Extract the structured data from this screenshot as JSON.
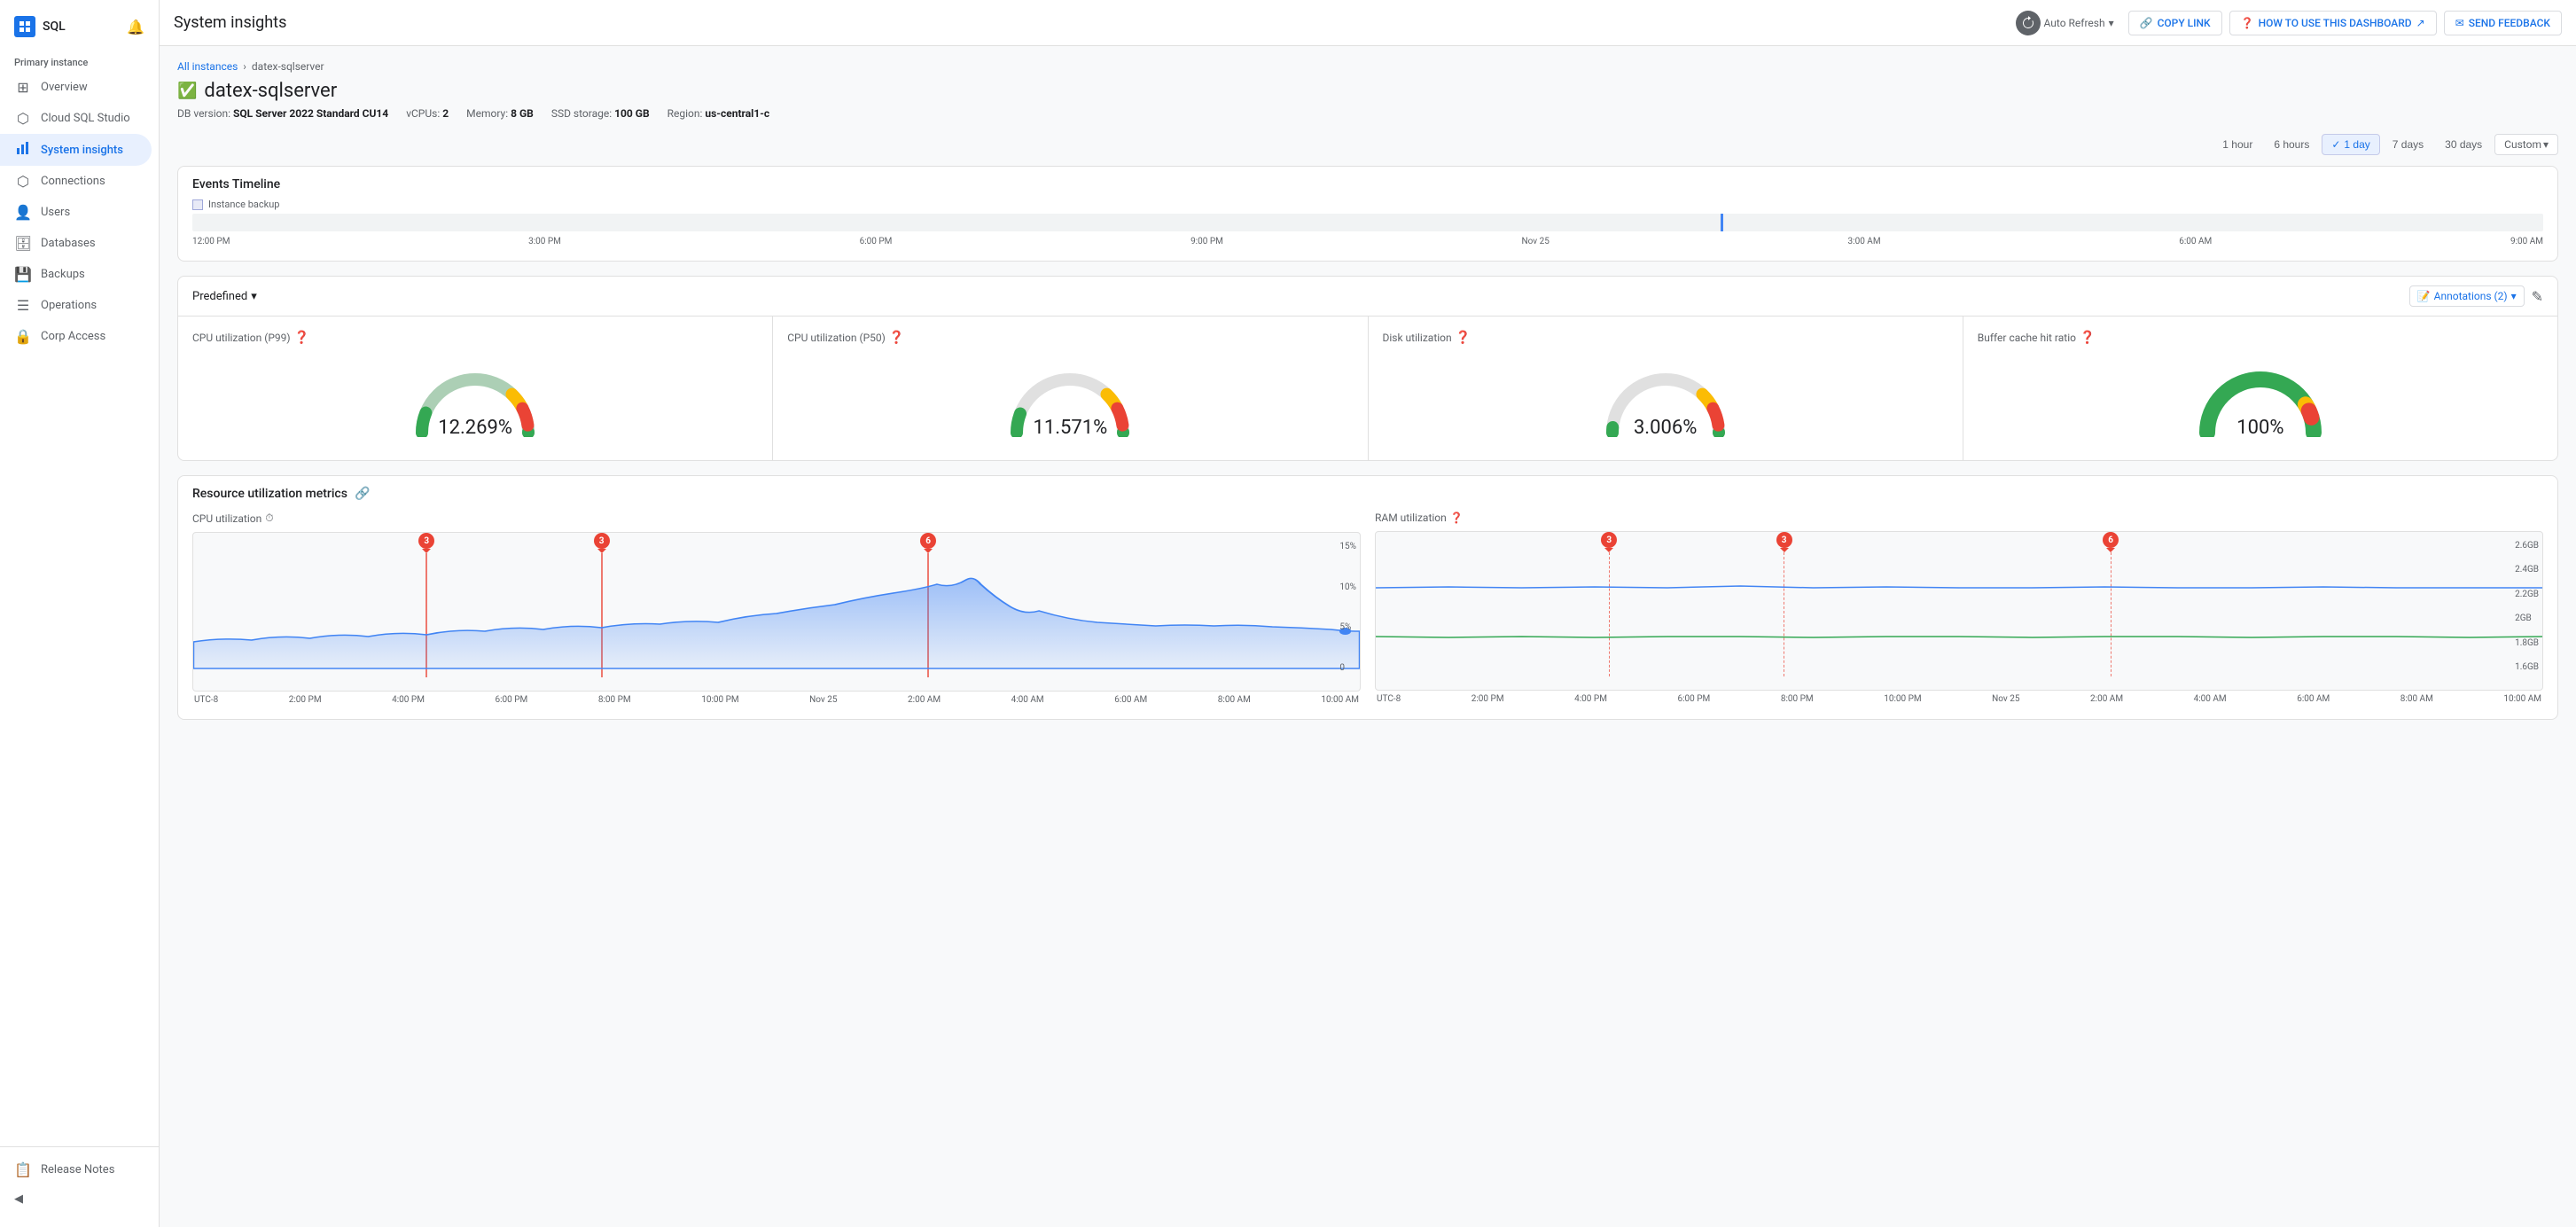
{
  "app": {
    "logo_text": "SQL",
    "title": "System insights"
  },
  "sidebar": {
    "section_label": "Primary instance",
    "items": [
      {
        "id": "overview",
        "label": "Overview",
        "icon": "⊞",
        "active": false
      },
      {
        "id": "cloud-sql-studio",
        "label": "Cloud SQL Studio",
        "icon": "⬡",
        "active": false
      },
      {
        "id": "system-insights",
        "label": "System insights",
        "icon": "📊",
        "active": true
      },
      {
        "id": "connections",
        "label": "Connections",
        "icon": "🔗",
        "active": false
      },
      {
        "id": "users",
        "label": "Users",
        "icon": "👤",
        "active": false
      },
      {
        "id": "databases",
        "label": "Databases",
        "icon": "🗄",
        "active": false
      },
      {
        "id": "backups",
        "label": "Backups",
        "icon": "💾",
        "active": false
      },
      {
        "id": "operations",
        "label": "Operations",
        "icon": "☰",
        "active": false
      },
      {
        "id": "corp-access",
        "label": "Corp Access",
        "icon": "🔒",
        "active": false
      }
    ],
    "footer": {
      "release_notes": "Release Notes",
      "collapse_label": "Collapse"
    }
  },
  "topbar": {
    "title": "System insights",
    "auto_refresh_label": "Auto Refresh",
    "copy_link_label": "COPY LINK",
    "how_to_label": "HOW TO USE THIS DASHBOARD",
    "send_feedback_label": "SEND FEEDBACK"
  },
  "breadcrumb": {
    "all_instances": "All instances",
    "separator": "›",
    "current": "datex-sqlserver"
  },
  "instance": {
    "name": "datex-sqlserver",
    "db_version_label": "DB version:",
    "db_version": "SQL Server 2022 Standard CU14",
    "vcpus_label": "vCPUs:",
    "vcpus": "2",
    "memory_label": "Memory:",
    "memory": "8 GB",
    "ssd_label": "SSD storage:",
    "ssd": "100 GB",
    "region_label": "Region:",
    "region": "us-central1-c"
  },
  "time_range": {
    "buttons": [
      "1 hour",
      "6 hours",
      "1 day",
      "7 days",
      "30 days"
    ],
    "active": "1 day",
    "custom": "Custom"
  },
  "events_timeline": {
    "title": "Events Timeline",
    "legend_label": "Instance backup",
    "x_labels": [
      "12:00 PM",
      "3:00 PM",
      "6:00 PM",
      "9:00 PM",
      "Nov 25",
      "3:00 AM",
      "6:00 AM",
      "9:00 AM"
    ]
  },
  "predefined": {
    "label": "Predefined",
    "annotations_label": "Annotations (2)"
  },
  "gauges": [
    {
      "id": "cpu-p99",
      "title": "CPU utilization (P99)",
      "value": "12.269%",
      "percent": 12.269,
      "color": "#34a853"
    },
    {
      "id": "cpu-p50",
      "title": "CPU utilization (P50)",
      "value": "11.571%",
      "percent": 11.571,
      "color": "#34a853"
    },
    {
      "id": "disk-util",
      "title": "Disk utilization",
      "value": "3.006%",
      "percent": 3.006,
      "color": "#34a853"
    },
    {
      "id": "buffer-cache",
      "title": "Buffer cache hit ratio",
      "value": "100%",
      "percent": 100,
      "color": "#34a853"
    }
  ],
  "resource_utilization": {
    "title": "Resource utilization metrics",
    "cpu_chart": {
      "title": "CPU utilization",
      "y_labels": [
        "15%",
        "10%",
        "5%",
        "0"
      ],
      "x_labels": [
        "UTC-8",
        "2:00 PM",
        "4:00 PM",
        "6:00 PM",
        "8:00 PM",
        "10:00 PM",
        "Nov 25",
        "2:00 AM",
        "4:00 AM",
        "6:00 AM",
        "8:00 AM",
        "10:00 AM"
      ],
      "alarms": [
        {
          "position": "20%",
          "count": "3"
        },
        {
          "position": "35%",
          "count": "3"
        },
        {
          "position": "63%",
          "count": "6"
        }
      ]
    },
    "ram_chart": {
      "title": "RAM utilization",
      "y_labels": [
        "2.6GB",
        "2.4GB",
        "2.2GB",
        "2GB",
        "1.8GB",
        "1.6GB"
      ],
      "x_labels": [
        "UTC-8",
        "2:00 PM",
        "4:00 PM",
        "6:00 PM",
        "8:00 PM",
        "10:00 PM",
        "Nov 25",
        "2:00 AM",
        "4:00 AM",
        "6:00 AM",
        "8:00 AM",
        "10:00 AM"
      ],
      "alarms": [
        {
          "position": "20%",
          "count": "3"
        },
        {
          "position": "35%",
          "count": "3"
        },
        {
          "position": "63%",
          "count": "6"
        }
      ]
    }
  }
}
